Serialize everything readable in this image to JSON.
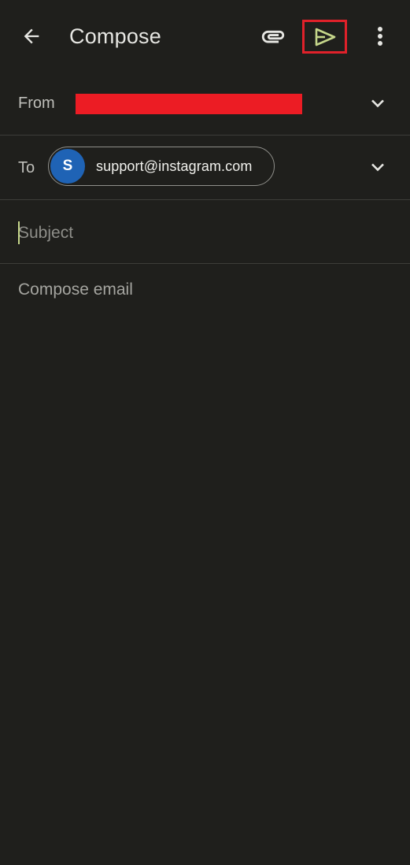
{
  "appbar": {
    "title": "Compose",
    "back_icon": "arrow-left-icon",
    "attach_icon": "paperclip-icon",
    "send_icon": "send-icon",
    "more_icon": "more-vertical-icon",
    "send_highlight_color": "#e0212a",
    "send_icon_color": "#c5d68a"
  },
  "from": {
    "label": "From",
    "value_redacted": true,
    "redaction_color": "#ec1c24"
  },
  "to": {
    "label": "To",
    "recipient": {
      "initial": "S",
      "email": "support@instagram.com",
      "avatar_color": "#1f63b5"
    }
  },
  "subject": {
    "placeholder": "Subject",
    "value": ""
  },
  "body": {
    "placeholder": "Compose email",
    "value": ""
  }
}
